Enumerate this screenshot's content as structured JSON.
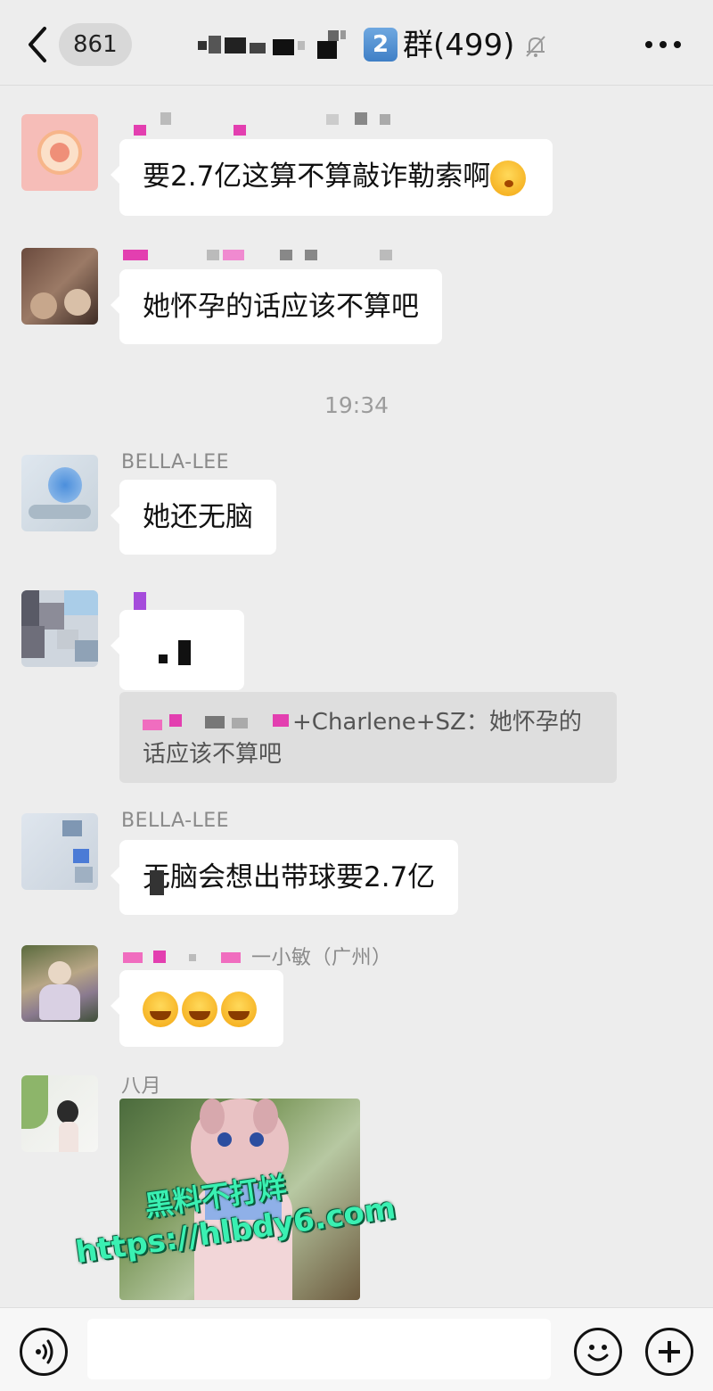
{
  "header": {
    "unread_count": "861",
    "group_number_badge": "2",
    "title_suffix": "群(499)"
  },
  "timestamp": "19:34",
  "messages": [
    {
      "text": "要2.7亿这算不算敲诈勒索啊"
    },
    {
      "text": "她怀孕的话应该不算吧"
    },
    {
      "sender": "BELLA-LEE",
      "text": "她还无脑"
    },
    {
      "quote_sender": "+Charlene+SZ：",
      "quote_text_line1": "她怀孕的",
      "quote_text_line2": "话应该不算吧"
    },
    {
      "sender": "BELLA-LEE",
      "text": "无脑会想出带球要2.7亿"
    },
    {
      "sender_suffix": "一小敏（广州）"
    },
    {
      "sender": "八月"
    }
  ],
  "watermark": {
    "line1": "黑料不打烊",
    "line2": "https://hlbdy6.com"
  },
  "icons": {
    "back": "chevron-left-icon",
    "mute": "bell-off-icon",
    "more": "ellipsis-icon",
    "voice": "voice-icon",
    "emoji": "smiley-icon",
    "plus": "plus-icon"
  }
}
